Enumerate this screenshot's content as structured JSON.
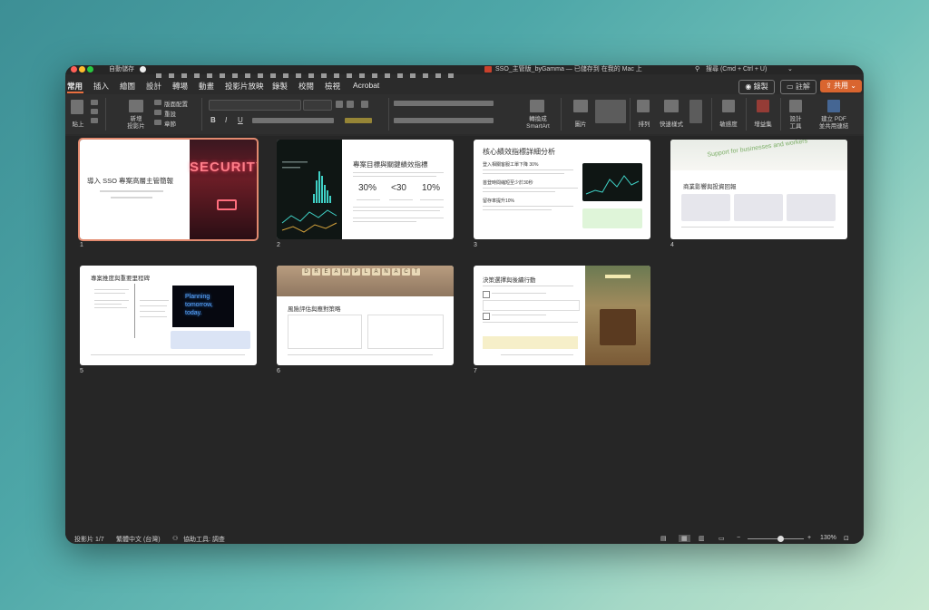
{
  "titlebar": {
    "autosave": "自動儲存",
    "doc_title": "SSO_主管版_byGamma — 已儲存到 在我的 Mac 上",
    "search": "搜尋 (Cmd + Ctrl + U)"
  },
  "tabs": [
    "常用",
    "插入",
    "繪圖",
    "設計",
    "轉場",
    "動畫",
    "投影片放映",
    "錄製",
    "校閱",
    "檢視",
    "Acrobat"
  ],
  "title_buttons": {
    "record": "錄製",
    "comment": "註解",
    "share": "共用"
  },
  "ribbon": {
    "paste": "貼上",
    "new_slide": "新增\n投影片",
    "layout": "版面配置",
    "reset": "重設",
    "section": "章節",
    "smartart": "轉換成\nSmartArt",
    "picture": "圖片",
    "arrange": "排列",
    "quick_styles": "快速樣式",
    "sensitivity": "敏感度",
    "addins": "增益集",
    "design_tools": "設計\n工具",
    "pdf": "建立 PDF\n並共用連結"
  },
  "slides": {
    "s1": {
      "num": "1",
      "title": "導入 SSO 專案高層主管簡報",
      "sign": "SECURITY"
    },
    "s2": {
      "num": "2",
      "title": "專案目標與關鍵績效指標",
      "kpi": [
        "30%",
        "<30",
        "10%"
      ],
      "kpi_labels": [
        "",
        "",
        ""
      ]
    },
    "s3": {
      "num": "3",
      "title": "核心績效指標詳細分析",
      "h1": "登入相關客服工單下降 30%",
      "h2": "首登時間縮短至少於30秒",
      "h3": "留存率提升10%"
    },
    "s4": {
      "num": "4",
      "title": "商業影響與投資回報",
      "banner": "Support for businesses and workers"
    },
    "s5": {
      "num": "5",
      "title": "專案推度與重要里程碑",
      "neon": [
        "Planning",
        "tomorrow,",
        "today."
      ]
    },
    "s6": {
      "num": "6",
      "title": "風險評估與應對策略",
      "tiles": [
        "D",
        "R",
        "E",
        "A",
        "M",
        "P",
        "L",
        "A",
        "N",
        "A",
        "C",
        "T"
      ]
    },
    "s7": {
      "num": "7",
      "title": "決策選擇與後續行動"
    }
  },
  "status": {
    "slide": "投影片 1/7",
    "lang": "繁體中文 (台灣)",
    "access": "協助工具: 調查",
    "zoom": "130%"
  }
}
